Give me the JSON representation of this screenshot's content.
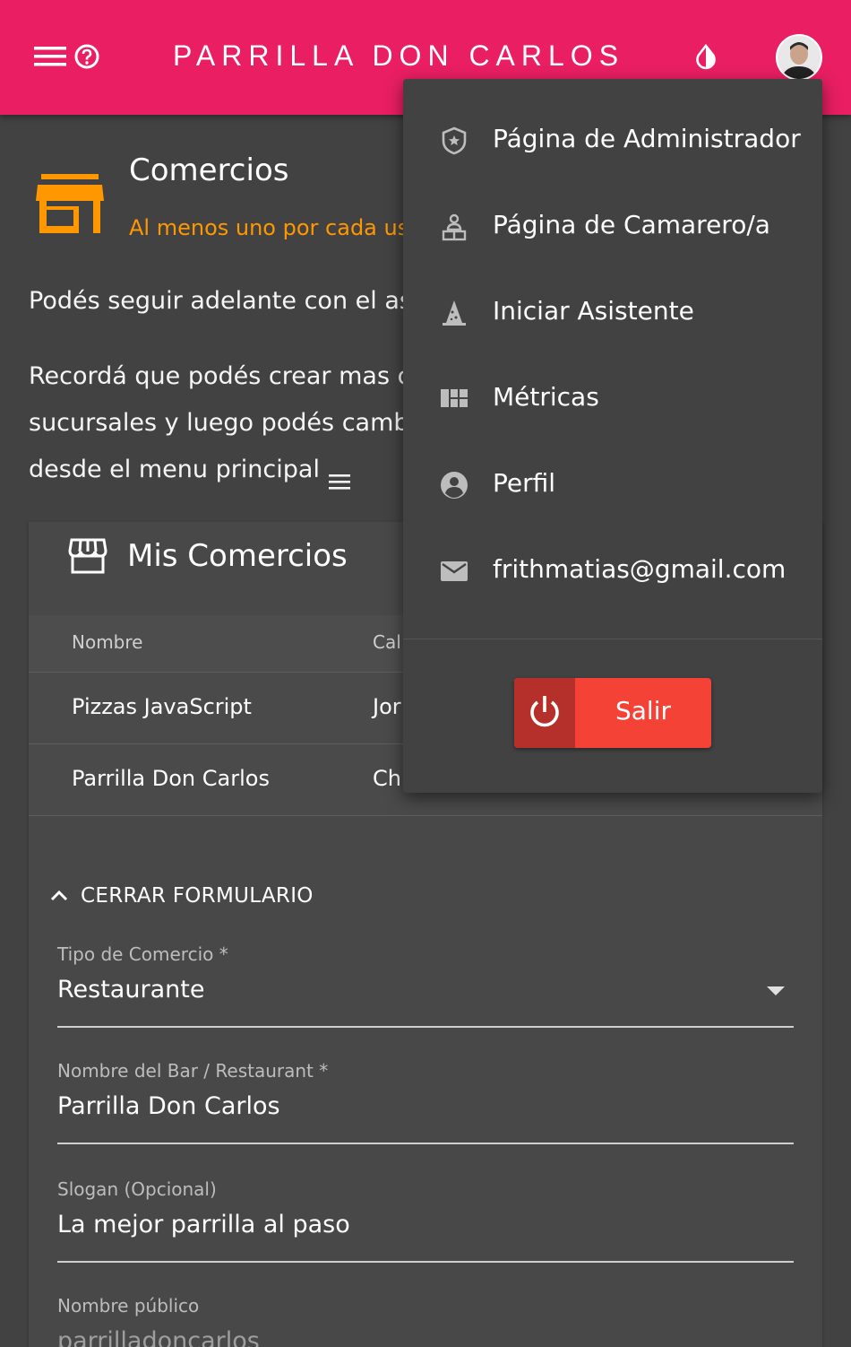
{
  "header": {
    "title": "PARRILLA DON CARLOS",
    "menu_icon": "menu-icon",
    "help_icon": "help-circle-icon",
    "theme_icon": "contrast-drop-icon",
    "avatar_icon": "user-avatar",
    "bg_color": "#e91e63"
  },
  "section": {
    "icon": "store-icon",
    "title": "Comercios",
    "subtitle": "Al menos uno por cada us",
    "subtitle_color": "#ff9800",
    "para1": "Podés seguir adelante con el as",
    "para2_line1": "Recordá que podés crear mas c",
    "para2_line2": "sucursales y luego podés camb",
    "para2_line3": "desde el menu principal"
  },
  "card": {
    "title": "Mis Comercios",
    "icon": "storefront-icon",
    "columns": [
      "Nombre",
      "Cal"
    ],
    "rows": [
      [
        "Pizzas JavaScript",
        "Jor"
      ],
      [
        "Parrilla Don Carlos",
        "Chi"
      ]
    ],
    "toggle_label": "CERRAR FORMULARIO",
    "fields": [
      {
        "label": "Tipo de Comercio *",
        "value": "Restaurante"
      },
      {
        "label": "Nombre del Bar / Restaurant *",
        "value": "Parrilla Don Carlos"
      },
      {
        "label": "Slogan (Opcional)",
        "value": "La mejor parrilla al paso"
      },
      {
        "label": "Nombre público",
        "value": "parrilladoncarlos"
      }
    ]
  },
  "dropdown": {
    "items": [
      {
        "label": "Página de Administrador",
        "icon": "shield-star-icon"
      },
      {
        "label": "Página de Camarero/a",
        "icon": "waiter-icon"
      },
      {
        "label": "Iniciar Asistente",
        "icon": "wizard-hat-icon"
      },
      {
        "label": "Métricas",
        "icon": "dashboard-icon"
      },
      {
        "label": "Perfil",
        "icon": "account-circle-icon"
      },
      {
        "label": "frithmatias@gmail.com",
        "icon": "email-icon"
      }
    ],
    "logout_label": "Salir",
    "logout_icon": "power-icon",
    "logout_color": "#f44336"
  }
}
